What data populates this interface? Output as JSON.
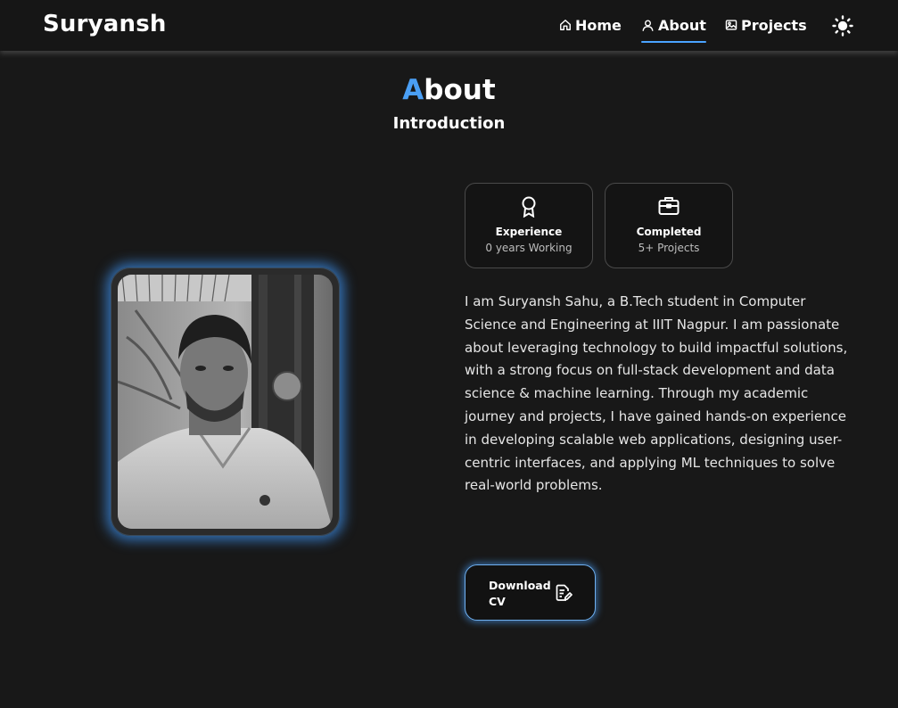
{
  "header": {
    "logo": "Suryansh",
    "nav": [
      {
        "label": "Home",
        "icon": "home-icon"
      },
      {
        "label": "About",
        "icon": "user-icon",
        "active": true
      },
      {
        "label": "Projects",
        "icon": "image-icon"
      }
    ],
    "theme_toggle_icon": "sun-icon"
  },
  "section": {
    "title_accent": "A",
    "title_rest": "bout",
    "subtitle": "Introduction"
  },
  "cards": [
    {
      "icon": "award-icon",
      "title": "Experience",
      "subtitle": "0 years Working"
    },
    {
      "icon": "briefcase-icon",
      "title": "Completed",
      "subtitle": "5+ Projects"
    }
  ],
  "description": "I am Suryansh Sahu, a B.Tech student in Computer Science and Engineering at IIIT Nagpur. I am passionate about leveraging technology to build impactful solutions, with a strong focus on full-stack development and data science & machine learning. Through my academic journey and projects, I have gained hands-on experience in developing scalable web applications, designing user-centric interfaces, and applying ML techniques to solve real-world problems.",
  "cv_button": {
    "label": "Download CV",
    "icon": "file-edit-icon"
  },
  "colors": {
    "accent": "#4a9ff5",
    "background": "#181818",
    "glow": "#3c8ce6"
  }
}
